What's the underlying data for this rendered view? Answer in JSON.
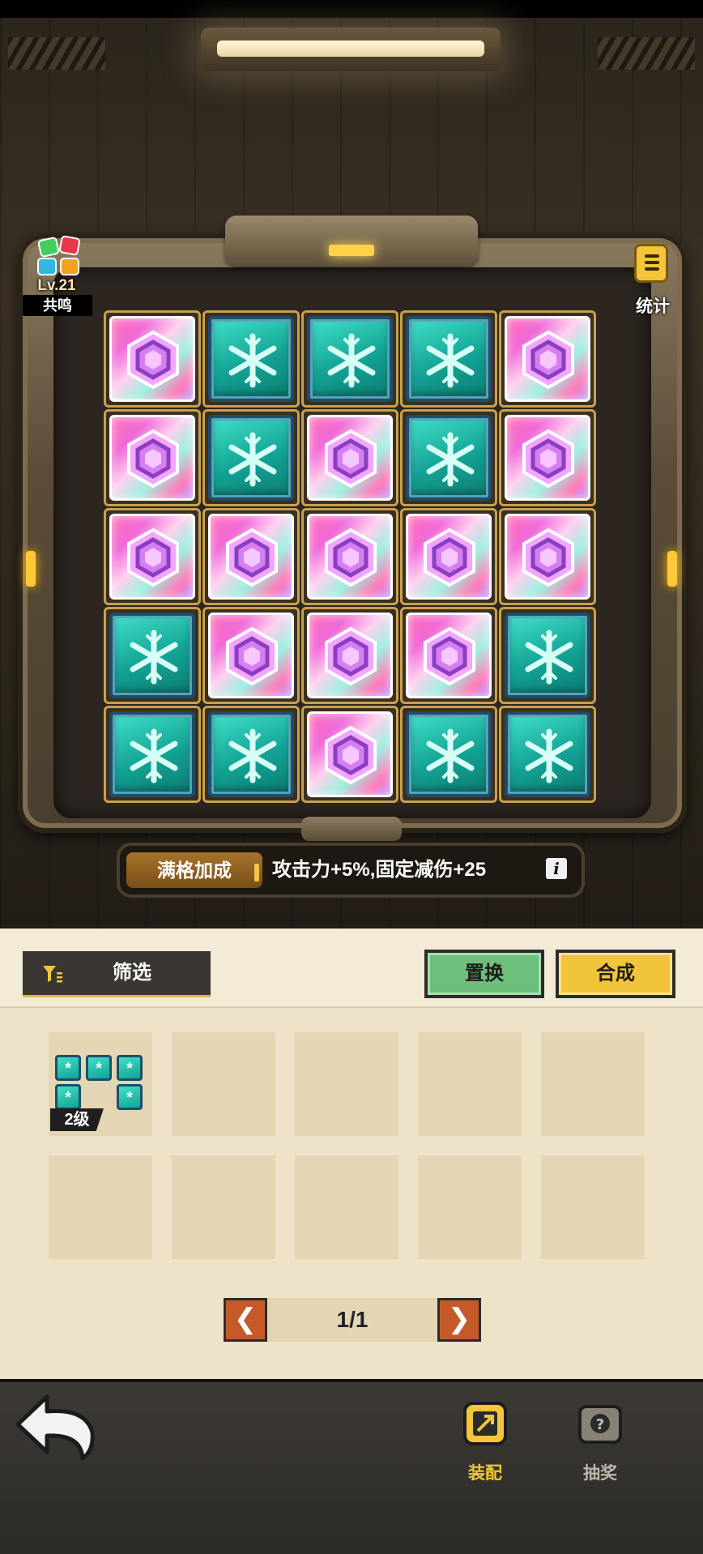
{
  "header": {
    "resonance_level": "Lv.21",
    "resonance_label": "共鸣",
    "stats_label": "统计"
  },
  "board": {
    "rows": [
      [
        "rainbow",
        "teal",
        "teal",
        "teal",
        "rainbow"
      ],
      [
        "rainbow",
        "teal",
        "rainbow",
        "teal",
        "rainbow"
      ],
      [
        "rainbow",
        "rainbow",
        "rainbow",
        "rainbow",
        "rainbow"
      ],
      [
        "teal",
        "rainbow",
        "rainbow",
        "rainbow",
        "teal"
      ],
      [
        "teal",
        "teal",
        "rainbow",
        "teal",
        "teal"
      ]
    ]
  },
  "bonus": {
    "tag": "满格加成",
    "text": "攻击力+5%,固定减伤+25",
    "info_icon": "i"
  },
  "inventory": {
    "filter_label": "筛选",
    "replace_label": "置换",
    "combine_label": "合成",
    "item_grade": "2级",
    "page": "1/1",
    "prev": "❮",
    "next": "❯"
  },
  "nav": {
    "equip_label": "装配",
    "lottery_label": "抽奖"
  },
  "colors": {
    "teal_tile": "#13a294",
    "gold_accent": "#f1c43a",
    "green_button": "#6ebf7c",
    "pager_orange": "#c45a28"
  }
}
